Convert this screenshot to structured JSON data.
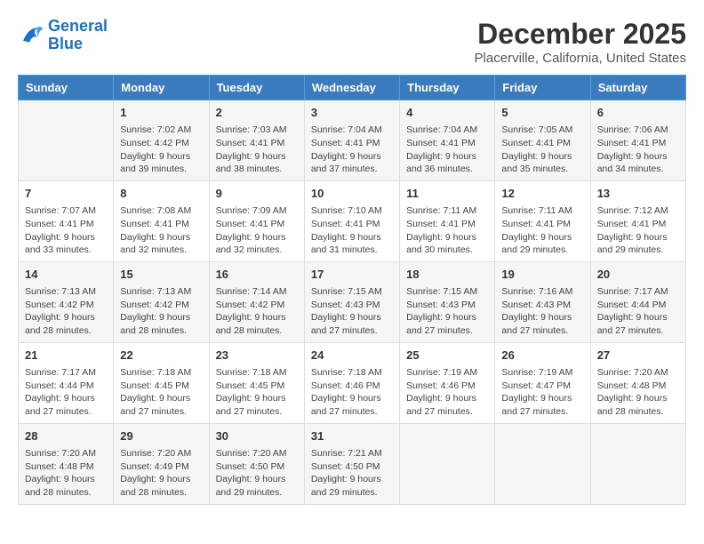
{
  "logo": {
    "text_general": "General",
    "text_blue": "Blue"
  },
  "title": "December 2025",
  "subtitle": "Placerville, California, United States",
  "days_header": [
    "Sunday",
    "Monday",
    "Tuesday",
    "Wednesday",
    "Thursday",
    "Friday",
    "Saturday"
  ],
  "weeks": [
    [
      {
        "day": "",
        "info": ""
      },
      {
        "day": "1",
        "info": "Sunrise: 7:02 AM\nSunset: 4:42 PM\nDaylight: 9 hours\nand 39 minutes."
      },
      {
        "day": "2",
        "info": "Sunrise: 7:03 AM\nSunset: 4:41 PM\nDaylight: 9 hours\nand 38 minutes."
      },
      {
        "day": "3",
        "info": "Sunrise: 7:04 AM\nSunset: 4:41 PM\nDaylight: 9 hours\nand 37 minutes."
      },
      {
        "day": "4",
        "info": "Sunrise: 7:04 AM\nSunset: 4:41 PM\nDaylight: 9 hours\nand 36 minutes."
      },
      {
        "day": "5",
        "info": "Sunrise: 7:05 AM\nSunset: 4:41 PM\nDaylight: 9 hours\nand 35 minutes."
      },
      {
        "day": "6",
        "info": "Sunrise: 7:06 AM\nSunset: 4:41 PM\nDaylight: 9 hours\nand 34 minutes."
      }
    ],
    [
      {
        "day": "7",
        "info": "Sunrise: 7:07 AM\nSunset: 4:41 PM\nDaylight: 9 hours\nand 33 minutes."
      },
      {
        "day": "8",
        "info": "Sunrise: 7:08 AM\nSunset: 4:41 PM\nDaylight: 9 hours\nand 32 minutes."
      },
      {
        "day": "9",
        "info": "Sunrise: 7:09 AM\nSunset: 4:41 PM\nDaylight: 9 hours\nand 32 minutes."
      },
      {
        "day": "10",
        "info": "Sunrise: 7:10 AM\nSunset: 4:41 PM\nDaylight: 9 hours\nand 31 minutes."
      },
      {
        "day": "11",
        "info": "Sunrise: 7:11 AM\nSunset: 4:41 PM\nDaylight: 9 hours\nand 30 minutes."
      },
      {
        "day": "12",
        "info": "Sunrise: 7:11 AM\nSunset: 4:41 PM\nDaylight: 9 hours\nand 29 minutes."
      },
      {
        "day": "13",
        "info": "Sunrise: 7:12 AM\nSunset: 4:41 PM\nDaylight: 9 hours\nand 29 minutes."
      }
    ],
    [
      {
        "day": "14",
        "info": "Sunrise: 7:13 AM\nSunset: 4:42 PM\nDaylight: 9 hours\nand 28 minutes."
      },
      {
        "day": "15",
        "info": "Sunrise: 7:13 AM\nSunset: 4:42 PM\nDaylight: 9 hours\nand 28 minutes."
      },
      {
        "day": "16",
        "info": "Sunrise: 7:14 AM\nSunset: 4:42 PM\nDaylight: 9 hours\nand 28 minutes."
      },
      {
        "day": "17",
        "info": "Sunrise: 7:15 AM\nSunset: 4:43 PM\nDaylight: 9 hours\nand 27 minutes."
      },
      {
        "day": "18",
        "info": "Sunrise: 7:15 AM\nSunset: 4:43 PM\nDaylight: 9 hours\nand 27 minutes."
      },
      {
        "day": "19",
        "info": "Sunrise: 7:16 AM\nSunset: 4:43 PM\nDaylight: 9 hours\nand 27 minutes."
      },
      {
        "day": "20",
        "info": "Sunrise: 7:17 AM\nSunset: 4:44 PM\nDaylight: 9 hours\nand 27 minutes."
      }
    ],
    [
      {
        "day": "21",
        "info": "Sunrise: 7:17 AM\nSunset: 4:44 PM\nDaylight: 9 hours\nand 27 minutes."
      },
      {
        "day": "22",
        "info": "Sunrise: 7:18 AM\nSunset: 4:45 PM\nDaylight: 9 hours\nand 27 minutes."
      },
      {
        "day": "23",
        "info": "Sunrise: 7:18 AM\nSunset: 4:45 PM\nDaylight: 9 hours\nand 27 minutes."
      },
      {
        "day": "24",
        "info": "Sunrise: 7:18 AM\nSunset: 4:46 PM\nDaylight: 9 hours\nand 27 minutes."
      },
      {
        "day": "25",
        "info": "Sunrise: 7:19 AM\nSunset: 4:46 PM\nDaylight: 9 hours\nand 27 minutes."
      },
      {
        "day": "26",
        "info": "Sunrise: 7:19 AM\nSunset: 4:47 PM\nDaylight: 9 hours\nand 27 minutes."
      },
      {
        "day": "27",
        "info": "Sunrise: 7:20 AM\nSunset: 4:48 PM\nDaylight: 9 hours\nand 28 minutes."
      }
    ],
    [
      {
        "day": "28",
        "info": "Sunrise: 7:20 AM\nSunset: 4:48 PM\nDaylight: 9 hours\nand 28 minutes."
      },
      {
        "day": "29",
        "info": "Sunrise: 7:20 AM\nSunset: 4:49 PM\nDaylight: 9 hours\nand 28 minutes."
      },
      {
        "day": "30",
        "info": "Sunrise: 7:20 AM\nSunset: 4:50 PM\nDaylight: 9 hours\nand 29 minutes."
      },
      {
        "day": "31",
        "info": "Sunrise: 7:21 AM\nSunset: 4:50 PM\nDaylight: 9 hours\nand 29 minutes."
      },
      {
        "day": "",
        "info": ""
      },
      {
        "day": "",
        "info": ""
      },
      {
        "day": "",
        "info": ""
      }
    ]
  ]
}
